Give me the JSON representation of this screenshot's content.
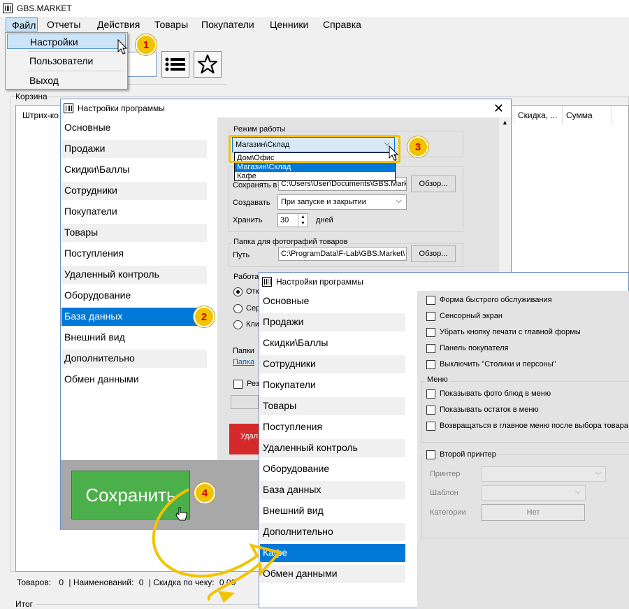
{
  "app": {
    "title": "GBS.MARKET"
  },
  "menu": {
    "items": [
      "Файл",
      "Отчеты",
      "Действия",
      "Товары",
      "Покупатели",
      "Ценники",
      "Справка"
    ],
    "file_dropdown": [
      "Настройки",
      "Пользователи",
      "Выход"
    ]
  },
  "cart": {
    "label": "Корзина",
    "columns": {
      "barcode": "Штрих-ко",
      "discount": "Скидка, ...",
      "sum": "Сумма"
    },
    "status": {
      "goods_label": "Товаров:",
      "goods_value": "0",
      "names_label": "| Наименований:",
      "names_value": "0",
      "discount_label": "| Скидка по чеку:",
      "discount_value": "0,00"
    },
    "total_label": "Итог"
  },
  "settings1": {
    "title": "Настройки программы",
    "nav": [
      "Основные",
      "Продажи",
      "Скидки\\Баллы",
      "Сотрудники",
      "Покупатели",
      "Товары",
      "Поступления",
      "Удаленный контроль",
      "Оборудование",
      "База данных",
      "Внешний вид",
      "Дополнительно",
      "Обмен данными"
    ],
    "selected": "База данных",
    "mode_group": "Режим работы",
    "mode_value": "Магазин\\Склад",
    "mode_options": [
      "Дом\\Офис",
      "Магазин\\Склад",
      "Кафе"
    ],
    "backup_path_label": "Сохранять в",
    "backup_path_value": "C:\\Users\\User\\Documents\\GBS.Mark",
    "browse": "Обзор...",
    "create_label": "Создавать",
    "create_value": "При запуске и закрытии",
    "keep_label": "Хранить",
    "keep_value": "30",
    "keep_unit": "дней",
    "photos_group": "Папка для фотографий товаров",
    "photos_path_label": "Путь",
    "photos_path_value": "C:\\ProgramData\\F-Lab\\GBS.Market\\",
    "work_group": "Работа",
    "radio1": "Отк",
    "radio2": "Сер",
    "radio3": "Кли",
    "folders_label": "Папки",
    "folders_link": "Папка",
    "reserve_label": "Рез",
    "delete_label": "Удал",
    "save_button": "Сохранить"
  },
  "settings2": {
    "title": "Настройки программы",
    "nav": [
      "Основные",
      "Продажи",
      "Скидки\\Баллы",
      "Сотрудники",
      "Покупатели",
      "Товары",
      "Поступления",
      "Удаленный контроль",
      "Оборудование",
      "База данных",
      "Внешний вид",
      "Дополнительно",
      "Кафе",
      "Обмен данными"
    ],
    "selected": "Кафе",
    "options": [
      "Форма быстрого обслуживания",
      "Сенсорный экран",
      "Убрать кнопку печати с главной формы",
      "Панель покупателя",
      "Выключить \"Столики и персоны\""
    ],
    "menu_group": "Меню",
    "menu_options": [
      "Показывать фото блюд в меню",
      "Показывать остаток в меню",
      "Возвращаться в главное меню после выбора товара"
    ],
    "printer_group": "Второй принтер",
    "printer_label": "Принтер",
    "template_label": "Шаблон",
    "categories_label": "Категории",
    "categories_button": "Нет"
  },
  "callouts": [
    "1",
    "2",
    "3",
    "4"
  ],
  "colors": {
    "accent": "#0078d7",
    "save_green": "#4cb04a",
    "callout_yellow": "#f2c300",
    "callout_text": "#cc0000",
    "delete_red": "#d42a2a"
  }
}
